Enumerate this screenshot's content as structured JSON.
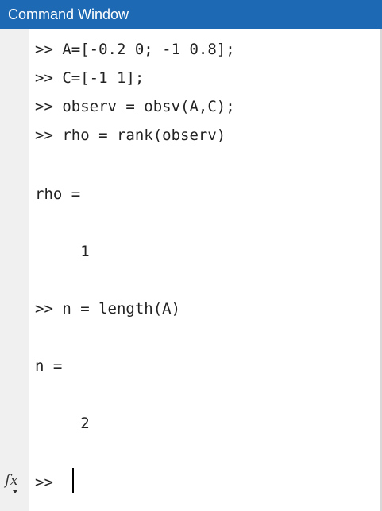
{
  "window": {
    "title": "Command Window"
  },
  "console": {
    "lines": [
      ">> A=[-0.2 0; -1 0.8];",
      ">> C=[-1 1];",
      ">> observ = obsv(A,C);",
      ">> rho = rank(observ)",
      "rho =",
      "     1",
      ">> n = length(A)",
      "n =",
      "     2"
    ]
  },
  "prompt": {
    "fx_label": "fx",
    "symbol": ">>"
  },
  "colors": {
    "titlebar_bg": "#1d69b3",
    "titlebar_text": "#ffffff",
    "gutter_bg": "#f0f0f0",
    "text": "#222222"
  },
  "icons": {
    "fx": "function-browser-icon"
  }
}
